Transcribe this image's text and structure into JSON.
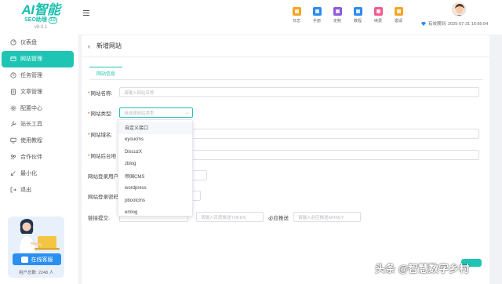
{
  "brand": {
    "name": "AI智能",
    "sub": "SEO助理",
    "badge": "3.0",
    "version": "v8.0.1"
  },
  "sidebar": {
    "items": [
      {
        "label": "仪表盘",
        "icon": "dashboard-icon",
        "active": false
      },
      {
        "label": "网站管理",
        "icon": "globe-icon",
        "active": true
      },
      {
        "label": "任务管理",
        "icon": "task-icon",
        "active": false
      },
      {
        "label": "文章管理",
        "icon": "article-icon",
        "active": false
      },
      {
        "label": "配置中心",
        "icon": "gear-icon",
        "active": false
      },
      {
        "label": "站长工具",
        "icon": "wrench-icon",
        "active": false
      },
      {
        "label": "使用教程",
        "icon": "monitor-icon",
        "active": false
      },
      {
        "label": "合作伙伴",
        "icon": "partner-icon",
        "active": false
      },
      {
        "label": "最小化",
        "icon": "minimize-icon",
        "active": false
      },
      {
        "label": "退出",
        "icon": "logout-icon",
        "active": false
      }
    ],
    "promo": {
      "service_label": "在线客服",
      "users_text": "用户总数: 2248 人"
    }
  },
  "header": {
    "tools": [
      {
        "label": "日志",
        "color": "#f5a623"
      },
      {
        "label": "手册",
        "color": "#2d8cf0"
      },
      {
        "label": "定制",
        "color": "#8e5cd9"
      },
      {
        "label": "教程",
        "color": "#2d8cf0"
      },
      {
        "label": "续费",
        "color": "#f25c8f"
      },
      {
        "label": "邀请",
        "color": "#f5a623"
      }
    ],
    "expiry": "有效期到: 2025-07-31 16:56:04"
  },
  "page": {
    "title": "新增网站",
    "tab_label": "网站信息",
    "fields": {
      "name": {
        "label": "网站名称:",
        "placeholder": "请输入网站名称"
      },
      "type": {
        "label": "网站类型:",
        "placeholder": "请选择网站类型"
      },
      "domain": {
        "label": "网站域名:"
      },
      "admin": {
        "label": "网站后台地"
      },
      "login_user": {
        "label": "网站登录用户"
      },
      "login_pass": {
        "label": "网站登录密码"
      },
      "submit": {
        "label": "链接提交:",
        "token_placeholder": "请输入百度推送TOKEN",
        "bing_label": "必应推送",
        "bing_placeholder": "请输入必应推送APIKEY"
      }
    },
    "type_options": [
      "自定义接口",
      "eyoucms",
      "DiscuzX",
      "zblog",
      "帝国CMS",
      "wordpress",
      "pbootcms",
      "emlog"
    ]
  },
  "watermark": "头条 @智慧数字乡村"
}
